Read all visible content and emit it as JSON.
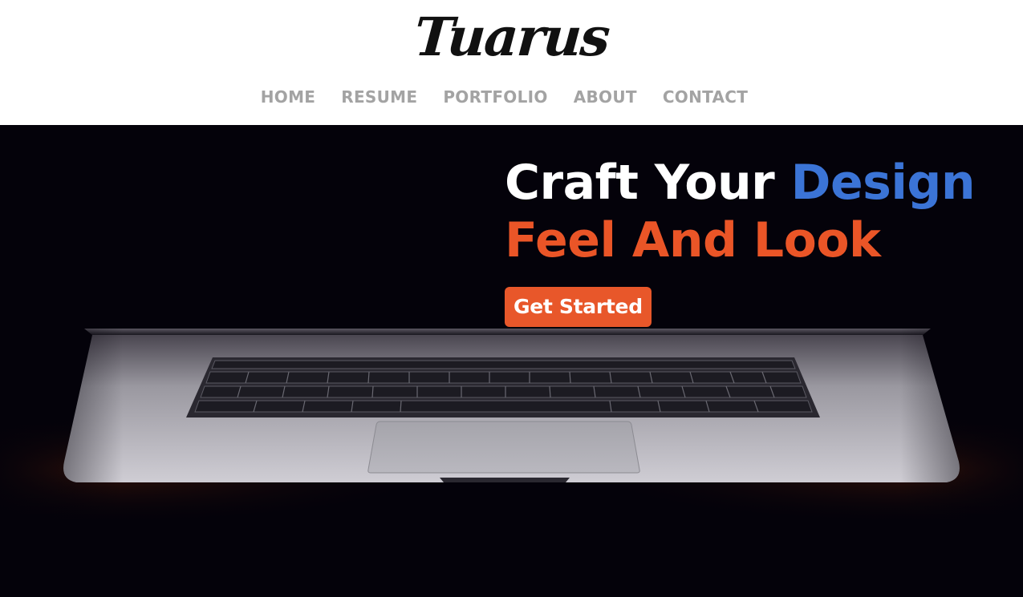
{
  "header": {
    "logo_text": "Tuarus",
    "nav": [
      {
        "label": "HOME"
      },
      {
        "label": "RESUME"
      },
      {
        "label": "PORTFOLIO"
      },
      {
        "label": "ABOUT"
      },
      {
        "label": "CONTACT"
      }
    ]
  },
  "hero": {
    "headline_line1_white": "Craft Your ",
    "headline_line1_blue": "Design",
    "headline_line2": "Feel And Look",
    "cta_label": "Get Started",
    "background_image": "laptop-keyboard-dark-photo"
  },
  "colors": {
    "nav_text": "#a3a3a3",
    "accent_blue": "#3b74d6",
    "accent_orange": "#ea5527",
    "hero_background": "#04020a"
  }
}
